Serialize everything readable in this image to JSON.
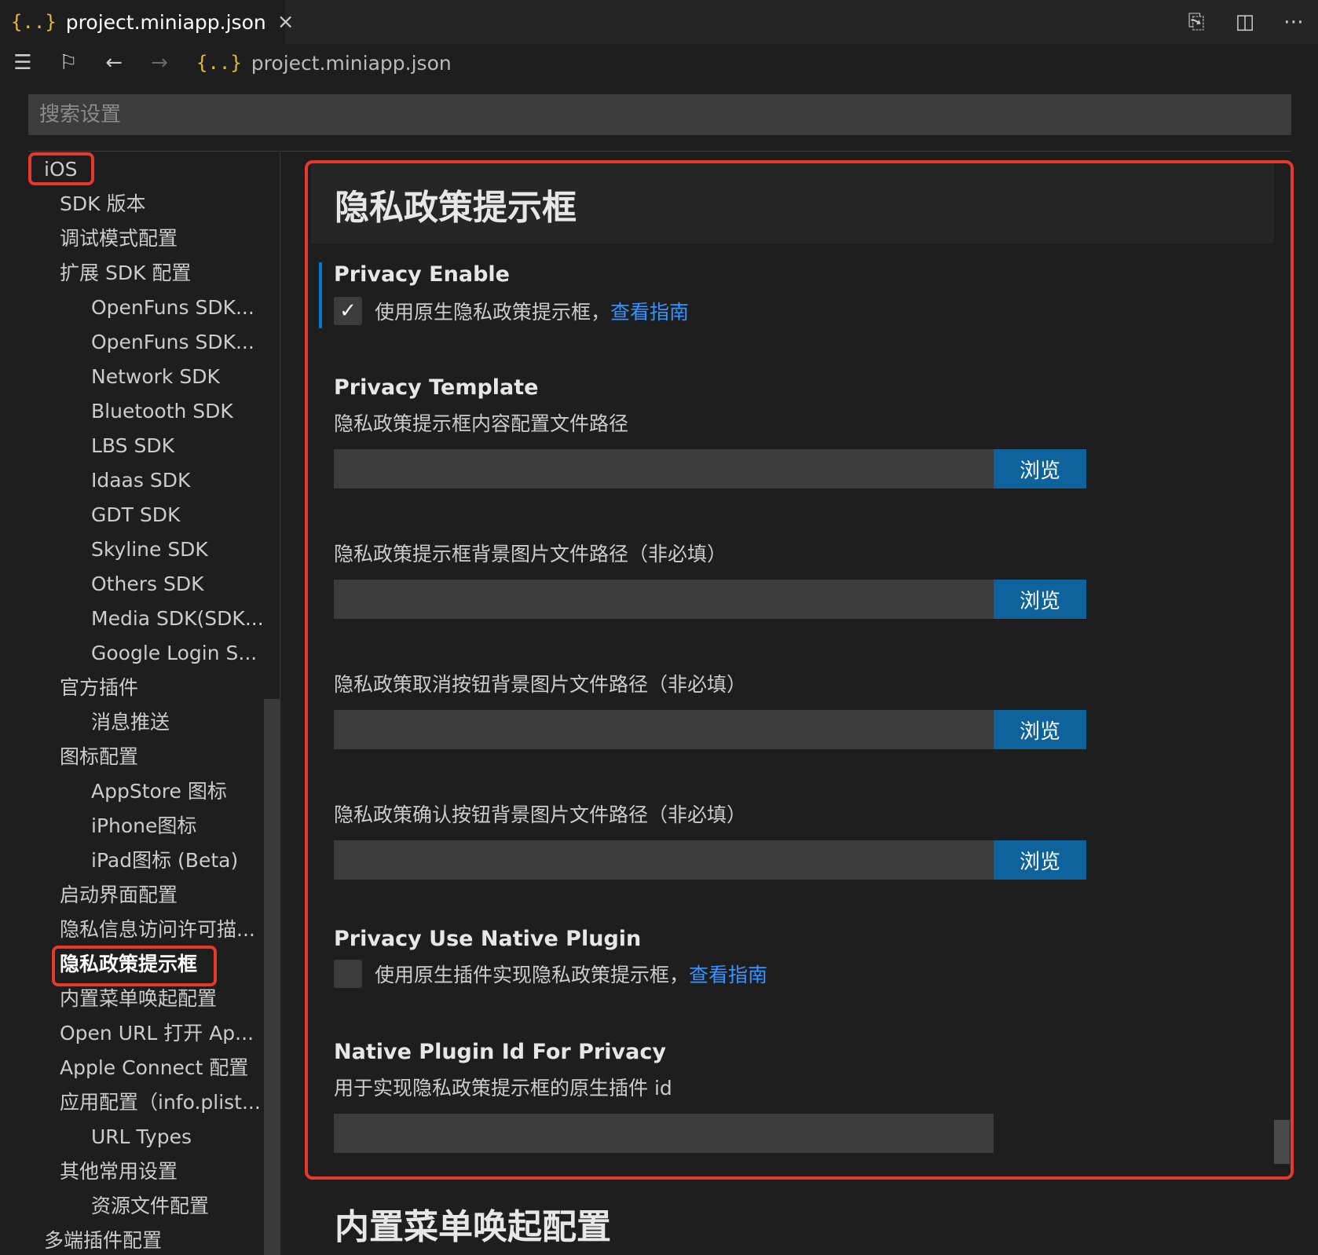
{
  "tab": {
    "icon": "{..}",
    "title": "project.miniapp.json",
    "close": "×"
  },
  "tab_actions": {
    "open_file_icon": "⎘",
    "split_icon": "◫",
    "more_icon": "⋯"
  },
  "breadcrumb": {
    "list_icon": "☰",
    "bookmark_icon": "⚐",
    "back_icon": "←",
    "forward_icon": "→",
    "file_icon": "{..}",
    "file": "project.miniapp.json"
  },
  "search": {
    "placeholder": "搜索设置"
  },
  "toc": [
    {
      "label": "iOS",
      "level": 0
    },
    {
      "label": "SDK 版本",
      "level": 1
    },
    {
      "label": "调试模式配置",
      "level": 1
    },
    {
      "label": "扩展 SDK 配置",
      "level": 1
    },
    {
      "label": "OpenFuns SDK...",
      "level": 2
    },
    {
      "label": "OpenFuns SDK...",
      "level": 2
    },
    {
      "label": "Network SDK",
      "level": 2
    },
    {
      "label": "Bluetooth SDK",
      "level": 2
    },
    {
      "label": "LBS SDK",
      "level": 2
    },
    {
      "label": "Idaas SDK",
      "level": 2
    },
    {
      "label": "GDT SDK",
      "level": 2
    },
    {
      "label": "Skyline SDK",
      "level": 2
    },
    {
      "label": "Others SDK",
      "level": 2
    },
    {
      "label": "Media SDK(SDK...",
      "level": 2
    },
    {
      "label": "Google Login S...",
      "level": 2
    },
    {
      "label": "官方插件",
      "level": 1
    },
    {
      "label": "消息推送",
      "level": 2
    },
    {
      "label": "图标配置",
      "level": 1
    },
    {
      "label": "AppStore 图标",
      "level": 2
    },
    {
      "label": "iPhone图标",
      "level": 2
    },
    {
      "label": "iPad图标 (Beta)",
      "level": 2
    },
    {
      "label": "启动界面配置",
      "level": 1
    },
    {
      "label": "隐私信息访问许可描...",
      "level": 1
    },
    {
      "label": "隐私政策提示框",
      "level": 1
    },
    {
      "label": "内置菜单唤起配置",
      "level": 1
    },
    {
      "label": "Open URL 打开 Ap...",
      "level": 1
    },
    {
      "label": "Apple Connect 配置",
      "level": 1
    },
    {
      "label": "应用配置（info.plist...",
      "level": 1
    },
    {
      "label": "URL Types",
      "level": 2
    },
    {
      "label": "其他常用设置",
      "level": 1
    },
    {
      "label": "资源文件配置",
      "level": 2
    },
    {
      "label": "多端插件配置",
      "level": 0
    }
  ],
  "section": {
    "title": "隐私政策提示框",
    "privacy_enable": {
      "title": "Privacy Enable",
      "checked": true,
      "check_glyph": "✓",
      "label": "使用原生隐私政策提示框，",
      "link": "查看指南"
    },
    "privacy_template": {
      "title": "Privacy Template",
      "desc": "隐私政策提示框内容配置文件路径",
      "value": "",
      "button": "浏览"
    },
    "bg_image": {
      "desc": "隐私政策提示框背景图片文件路径（非必填）",
      "value": "",
      "button": "浏览"
    },
    "cancel_bg": {
      "desc": "隐私政策取消按钮背景图片文件路径（非必填）",
      "value": "",
      "button": "浏览"
    },
    "confirm_bg": {
      "desc": "隐私政策确认按钮背景图片文件路径（非必填）",
      "value": "",
      "button": "浏览"
    },
    "native_plugin": {
      "title": "Privacy Use Native Plugin",
      "checked": false,
      "label": "使用原生插件实现隐私政策提示框，",
      "link": "查看指南"
    },
    "plugin_id": {
      "title": "Native Plugin Id For Privacy",
      "desc": "用于实现隐私政策提示框的原生插件 id",
      "value": ""
    }
  },
  "next_section": {
    "title": "内置菜单唤起配置"
  },
  "colors": {
    "highlight": "#e53a2b",
    "accent": "#0e639c",
    "link": "#3794ff"
  }
}
